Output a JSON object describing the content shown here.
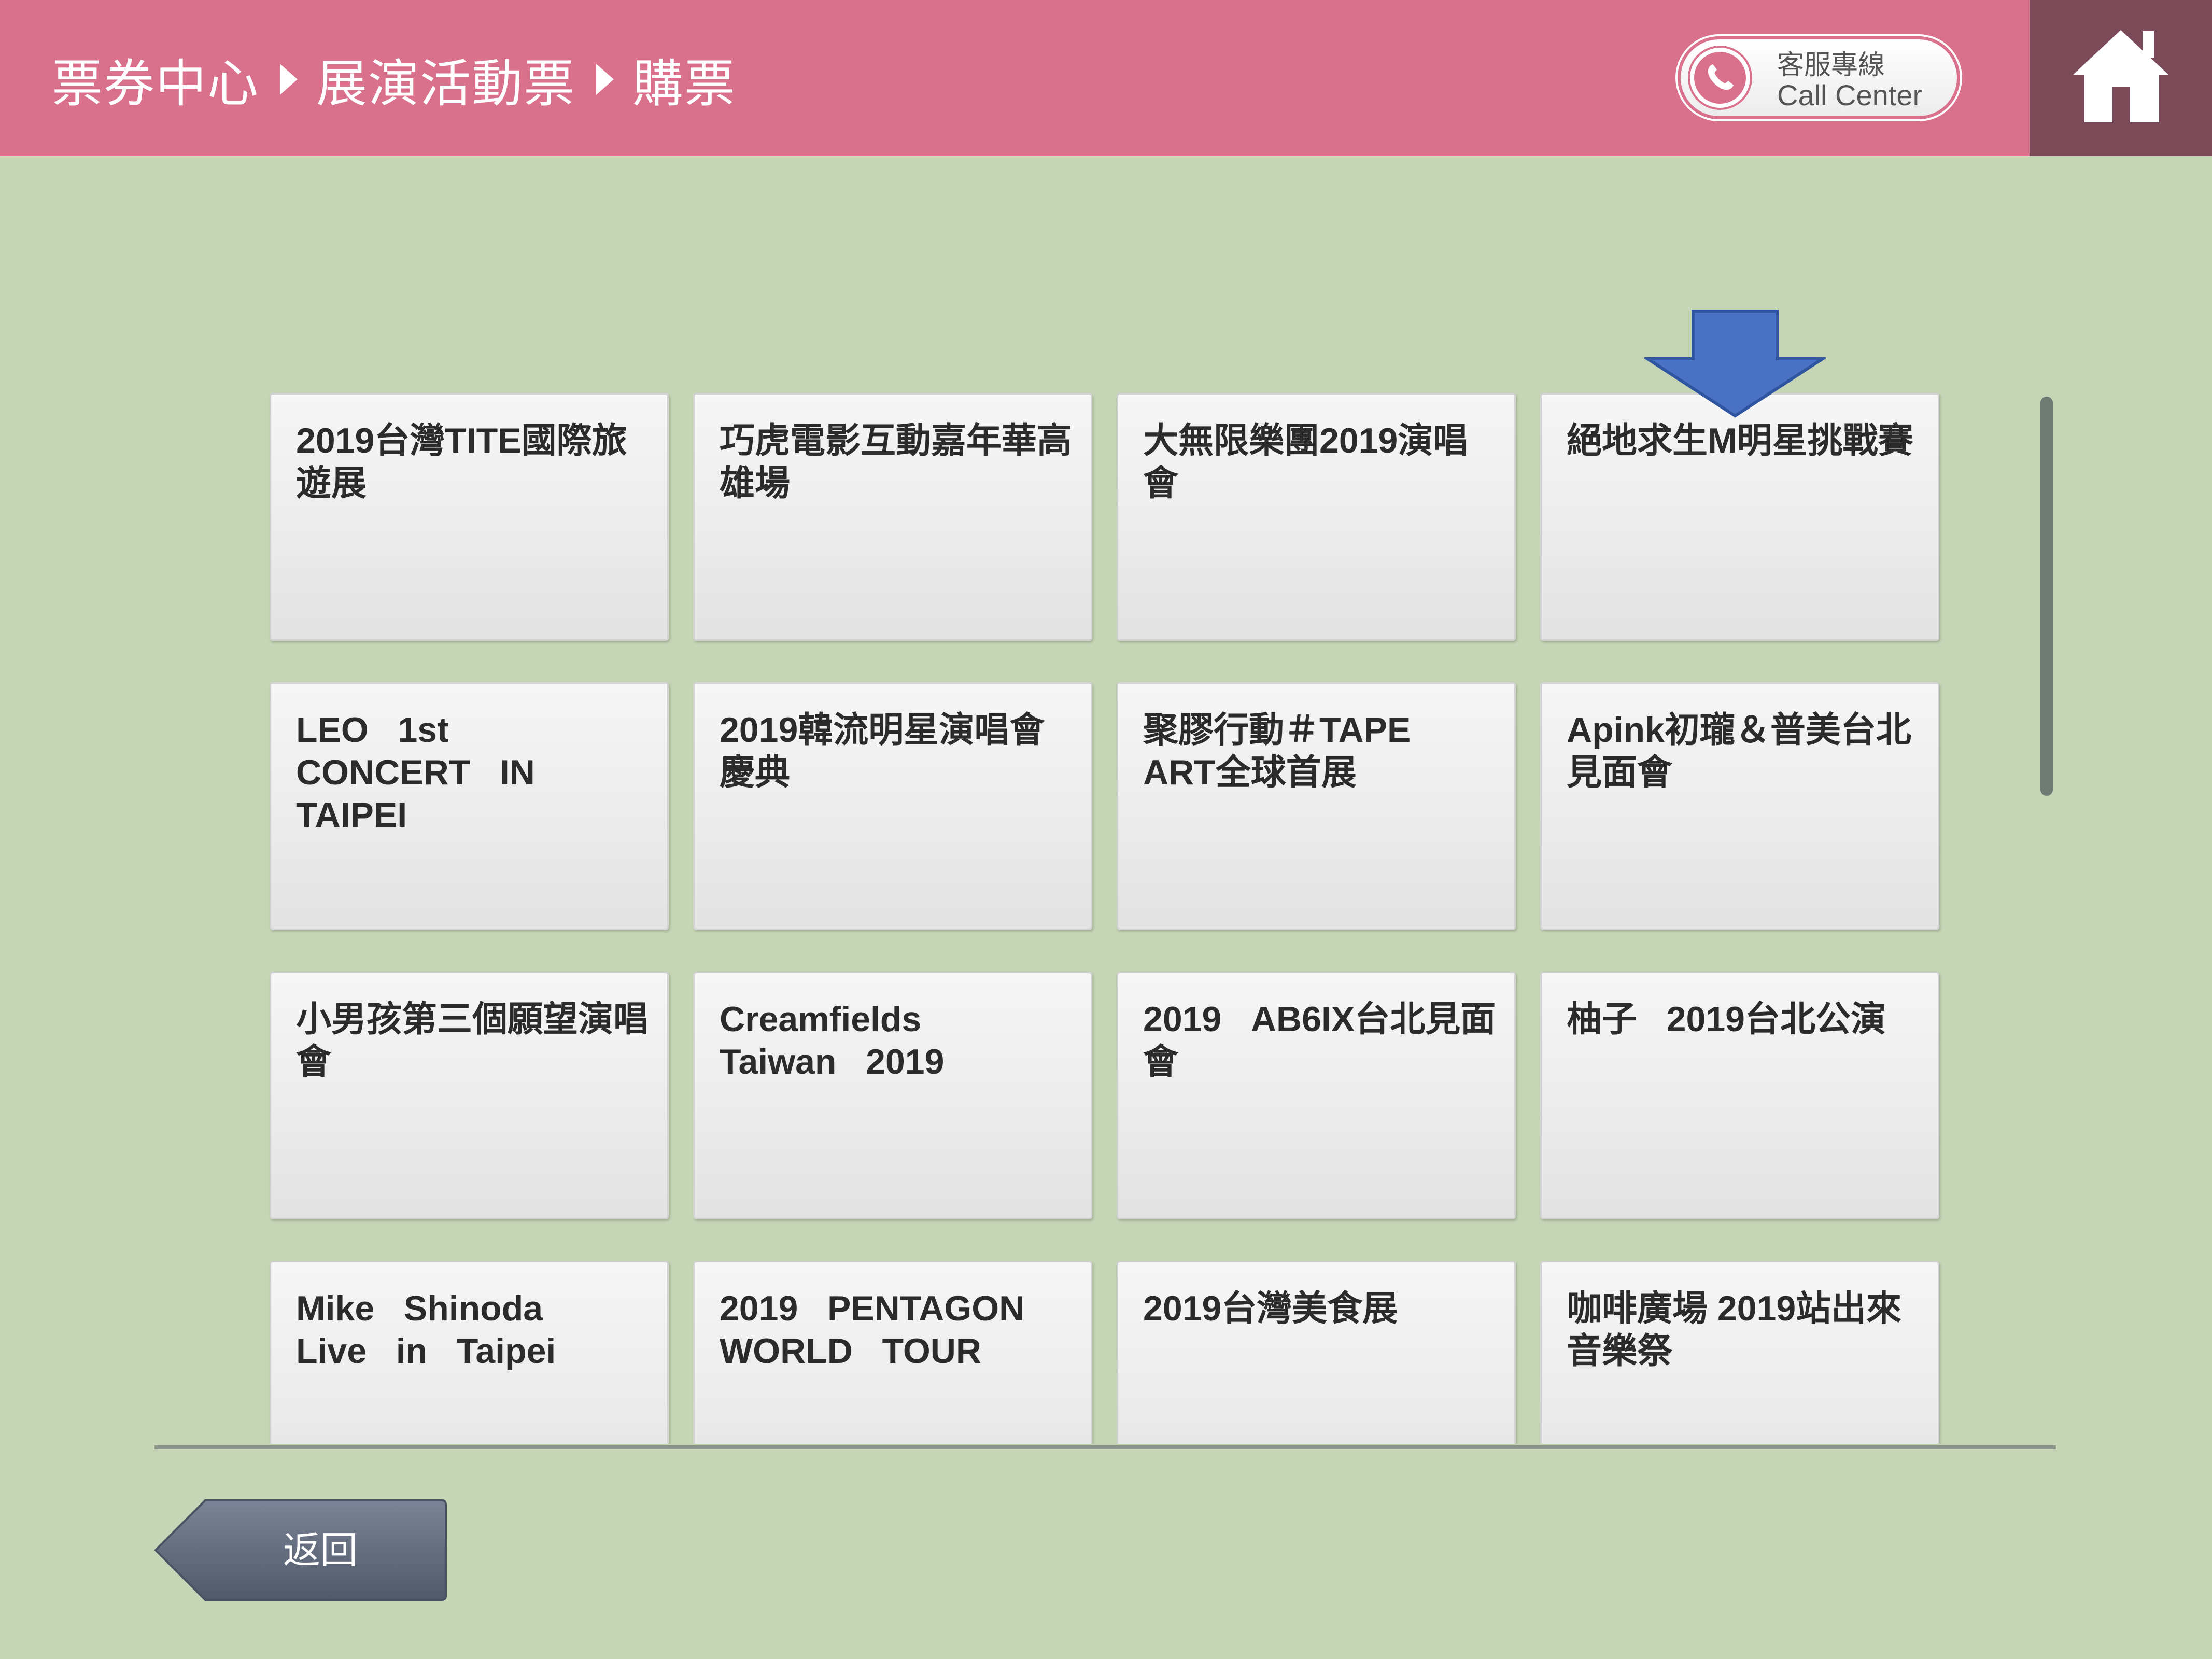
{
  "header": {
    "breadcrumb": [
      "票券中心",
      "展演活動票",
      "購票"
    ],
    "call_center": {
      "line1": "客服專線",
      "line2": "Call Center",
      "icon": "phone-icon"
    },
    "home_icon": "home-icon"
  },
  "events": [
    {
      "title": "2019台灣TITE國際旅遊展"
    },
    {
      "title": "巧虎電影互動嘉年華高雄場"
    },
    {
      "title": "大無限樂團2019演唱會"
    },
    {
      "title": "絕地求生M明星挑戰賽"
    },
    {
      "title": "LEO   1st\nCONCERT   IN\nTAIPEI"
    },
    {
      "title": "2019韓流明星演唱會慶典"
    },
    {
      "title": "聚膠行動＃TAPE\nART全球首展"
    },
    {
      "title": "Apink初瓏＆普美台北見面會"
    },
    {
      "title": "小男孩第三個願望演唱會"
    },
    {
      "title": "Creamfields\nTaiwan   2019"
    },
    {
      "title": "2019   AB6IX台北見面會"
    },
    {
      "title": "柚子   2019台北公演"
    },
    {
      "title": "Mike   Shinoda\nLive   in   Taipei"
    },
    {
      "title": "2019   PENTAGON\nWORLD   TOUR"
    },
    {
      "title": "2019台灣美食展"
    },
    {
      "title": "咖啡廣場 2019站出來音樂祭"
    }
  ],
  "footer": {
    "back_label": "返回"
  },
  "colors": {
    "header_bg": "#d9708c",
    "home_bg": "#7b4a58",
    "page_bg": "#c5d5b5",
    "arrow": "#4a72c4",
    "back_button": "#5e6878"
  }
}
